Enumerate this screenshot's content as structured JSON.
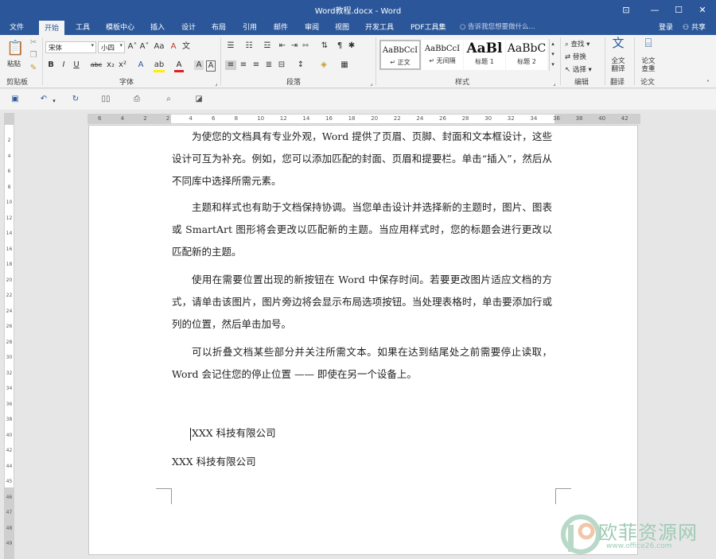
{
  "window": {
    "title": "Word教程.docx - Word",
    "controls": [
      "⊡",
      "—",
      "☐",
      "✕"
    ]
  },
  "menu": {
    "tabs": [
      "文件",
      "开始",
      "工具",
      "模板中心",
      "插入",
      "设计",
      "布局",
      "引用",
      "邮件",
      "审阅",
      "视图",
      "开发工具",
      "PDF工具集"
    ],
    "active": "开始",
    "tell_me": "告诉我您想要做什么...",
    "login": "登录",
    "share": "共享"
  },
  "ribbon": {
    "clipboard": {
      "label": "剪贴板",
      "paste": "粘贴"
    },
    "font": {
      "label": "字体",
      "name": "宋体",
      "size": "小四",
      "buttons": [
        "B",
        "I",
        "U",
        "abc",
        "x₂",
        "x²"
      ],
      "grow": "A˄",
      "shrink": "A˅",
      "case": "Aa",
      "clear": "A",
      "phonetic": "文",
      "border": "A"
    },
    "paragraph": {
      "label": "段落"
    },
    "styles": {
      "label": "样式",
      "items": [
        {
          "preview": "AaBbCcI",
          "name": "↵ 正文"
        },
        {
          "preview": "AaBbCcI",
          "name": "↵ 无间隔"
        },
        {
          "preview": "AaBl",
          "name": "标题 1"
        },
        {
          "preview": "AaBbC",
          "name": "标题 2"
        }
      ]
    },
    "editing": {
      "label": "编辑",
      "find": "查找",
      "replace": "替换",
      "select": "选择"
    },
    "translate": {
      "label": "翻译",
      "button": "全文翻译"
    },
    "paper": {
      "label": "论文",
      "button": "论文查重"
    }
  },
  "ruler": {
    "h_numbers": [
      "6",
      "4",
      "2",
      "2",
      "4",
      "6",
      "8",
      "10",
      "12",
      "14",
      "16",
      "18",
      "20",
      "22",
      "24",
      "26",
      "28",
      "30",
      "32",
      "34",
      "36",
      "38",
      "40",
      "42"
    ],
    "v_numbers": [
      "2",
      "4",
      "6",
      "8",
      "10",
      "12",
      "14",
      "16",
      "18",
      "20",
      "22",
      "24",
      "26",
      "28",
      "30",
      "32",
      "34",
      "36",
      "38",
      "40",
      "42",
      "44",
      "45",
      "46",
      "47",
      "48",
      "49"
    ]
  },
  "document": {
    "paragraphs": [
      "为使您的文档具有专业外观，Word 提供了页眉、页脚、封面和文本框设计，这些设计可互为补充。例如，您可以添加匹配的封面、页眉和提要栏。单击“插入”，然后从不同库中选择所需元素。",
      "主题和样式也有助于文档保持协调。当您单击设计并选择新的主题时，图片、图表或 SmartArt 图形将会更改以匹配新的主题。当应用样式时，您的标题会进行更改以匹配新的主题。",
      "使用在需要位置出现的新按钮在 Word 中保存时间。若要更改图片适应文档的方式，请单击该图片，图片旁边将会显示布局选项按钮。当处理表格时，单击要添加行或列的位置，然后单击加号。",
      "可以折叠文档某些部分并关注所需文本。如果在达到结尾处之前需要停止读取，Word 会记住您的停止位置 —— 即使在另一个设备上。"
    ],
    "company_1": "XXX 科技有限公司",
    "company_2": "XXX 科技有限公司"
  },
  "watermark": {
    "text": "欧菲资源网",
    "url": "www.office26.com"
  }
}
